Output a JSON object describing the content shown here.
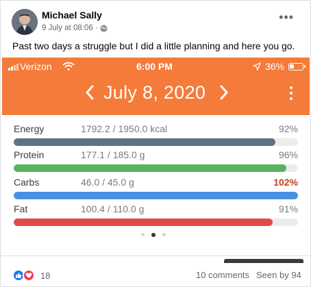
{
  "post": {
    "author": "Michael Sally",
    "date": "9 July at 08:06",
    "date_separator": "·",
    "more_label": "•••",
    "caption": "Past two days a struggle but I did a little planning and here you go.",
    "privacy_icon": "globe-icon"
  },
  "screenshot": {
    "status_bar": {
      "carrier": "Verizon",
      "time": "6:00 PM",
      "battery": "36%",
      "battery_level": 0.36
    },
    "header": {
      "date": "July 8, 2020",
      "prev_icon": "chevron-left-icon",
      "next_icon": "chevron-right-icon",
      "menu_icon": "kebab-menu-icon",
      "background_color": "#f47b3a"
    },
    "nutrients": [
      {
        "label": "Energy",
        "value": "1792.2 / 1950.0 kcal",
        "percent": "92%",
        "fill": 0.92,
        "color": "#5e7284"
      },
      {
        "label": "Protein",
        "value": "177.1 / 185.0 g",
        "percent": "96%",
        "fill": 0.96,
        "color": "#59b25f"
      },
      {
        "label": "Carbs",
        "value": "46.0 / 45.0 g",
        "percent": "102%",
        "fill": 1.0,
        "color": "#4a90e2",
        "over": true
      },
      {
        "label": "Fat",
        "value": "100.4 / 110.0 g",
        "percent": "91%",
        "fill": 0.91,
        "color": "#de4c4a"
      }
    ],
    "pager": {
      "count": 3,
      "active": 1
    }
  },
  "footer": {
    "reaction_count": "18",
    "comments": "10 comments",
    "seen": "Seen by 94"
  }
}
